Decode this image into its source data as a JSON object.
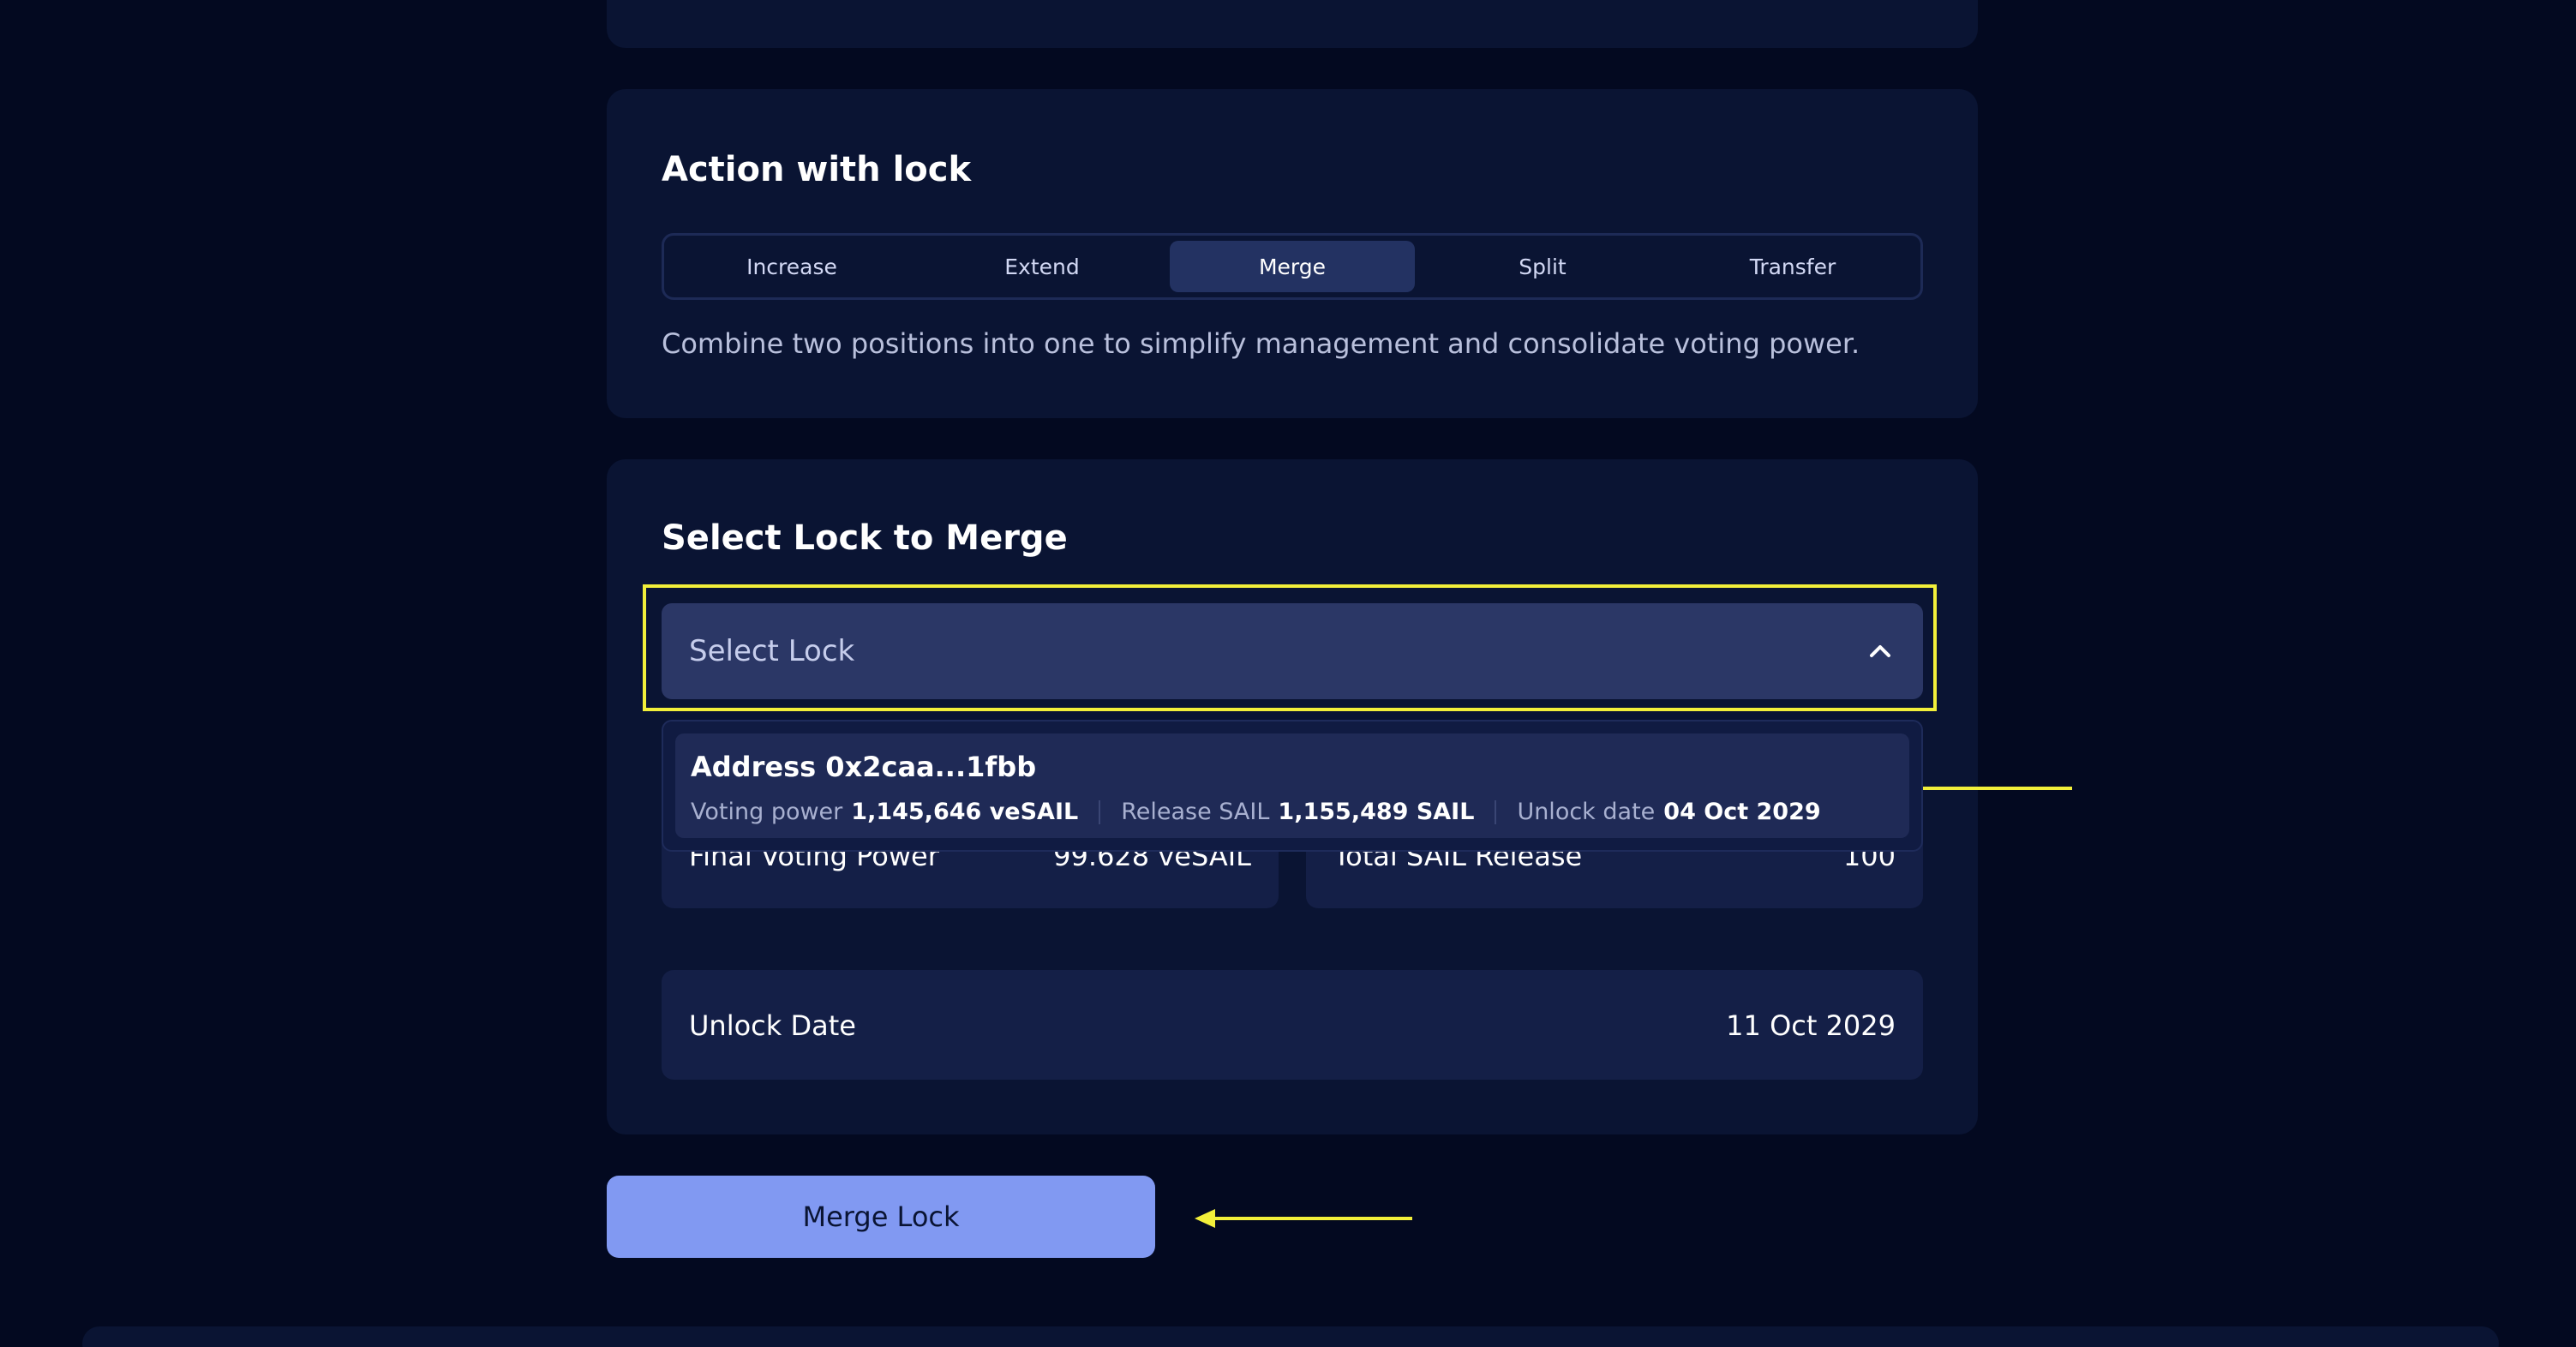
{
  "colors": {
    "background": "#030920",
    "panel": "#0a1433",
    "accent_button": "#8199f2",
    "annotation": "#f2ef3a"
  },
  "action_panel": {
    "title": "Action with lock",
    "tabs": [
      {
        "label": "Increase"
      },
      {
        "label": "Extend"
      },
      {
        "label": "Merge",
        "active": true
      },
      {
        "label": "Split"
      },
      {
        "label": "Transfer"
      }
    ],
    "description": "Combine two positions into one to simplify management and consolidate voting power."
  },
  "select_panel": {
    "title": "Select Lock to Merge",
    "select_placeholder": "Select Lock",
    "dropdown_options": [
      {
        "address": "Address 0x2caa...1fbb",
        "voting_power_label": "Voting power",
        "voting_power_value": "1,145,646 veSAIL",
        "release_label": "Release SAIL",
        "release_value": "1,155,489 SAIL",
        "unlock_label": "Unlock date",
        "unlock_value": "04 Oct 2029"
      }
    ],
    "final_voting_power": {
      "label": "Final Voting Power",
      "value": "99.628 veSAIL"
    },
    "total_sail_release": {
      "label": "Total SAIL Release",
      "value": "100"
    },
    "unlock_date": {
      "label": "Unlock Date",
      "value": "11 Oct 2029"
    }
  },
  "merge_button": {
    "label": "Merge Lock"
  }
}
